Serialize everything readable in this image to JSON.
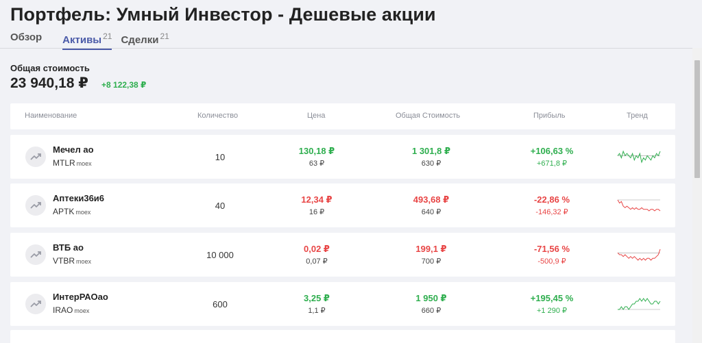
{
  "title": "Портфель: Умный Инвестор - Дешевые акции",
  "tabs": [
    {
      "label": "Обзор",
      "count": ""
    },
    {
      "label": "Активы",
      "count": "21"
    },
    {
      "label": "Сделки",
      "count": "21"
    }
  ],
  "summary": {
    "label": "Общая стоимость",
    "value": "23 940,18 ₽",
    "delta": "+8 122,38 ₽"
  },
  "columns": [
    "Наименование",
    "Количество",
    "Цена",
    "Общая Стоимость",
    "Прибыль",
    "Тренд"
  ],
  "rows": [
    {
      "name": "Мечел ао",
      "ticker": "MTLR",
      "exchange": "moex",
      "quantity": "10",
      "price": "130,18 ₽",
      "price_buy": "63 ₽",
      "cost": "1 301,8 ₽",
      "cost_buy": "630 ₽",
      "profit_pct": "+106,63 %",
      "profit_abs": "+671,8 ₽",
      "direction": "up",
      "trend": [
        5,
        6,
        4,
        7,
        5,
        6,
        5,
        4,
        6,
        3,
        5,
        4,
        6,
        2,
        4,
        3,
        5,
        4,
        3,
        5,
        4,
        6,
        5,
        7
      ]
    },
    {
      "name": "Аптеки36и6",
      "ticker": "APTK",
      "exchange": "moex",
      "quantity": "40",
      "price": "12,34 ₽",
      "price_buy": "16 ₽",
      "cost": "493,68 ₽",
      "cost_buy": "640 ₽",
      "profit_pct": "-22,86 %",
      "profit_abs": "-146,32 ₽",
      "direction": "down",
      "trend": [
        9,
        7,
        8,
        5,
        4,
        5,
        4,
        3,
        4,
        3,
        4,
        3,
        3,
        4,
        3,
        3,
        3,
        2,
        3,
        3,
        2,
        3,
        3,
        2
      ]
    },
    {
      "name": "ВТБ ао",
      "ticker": "VTBR",
      "exchange": "moex",
      "quantity": "10 000",
      "price": "0,02 ₽",
      "price_buy": "0,07 ₽",
      "cost": "199,1 ₽",
      "cost_buy": "700 ₽",
      "profit_pct": "-71,56 %",
      "profit_abs": "-500,9 ₽",
      "direction": "down",
      "trend": [
        6,
        5,
        5,
        4,
        5,
        4,
        3,
        4,
        3,
        4,
        3,
        2,
        3,
        2,
        3,
        2,
        3,
        3,
        2,
        3,
        3,
        4,
        5,
        8
      ]
    },
    {
      "name": "ИнтерРАОао",
      "ticker": "IRAO",
      "exchange": "moex",
      "quantity": "600",
      "price": "3,25 ₽",
      "price_buy": "1,1 ₽",
      "cost": "1 950 ₽",
      "cost_buy": "660 ₽",
      "profit_pct": "+195,45 %",
      "profit_abs": "+1 290 ₽",
      "direction": "up",
      "trend": [
        3,
        3,
        4,
        3,
        4,
        4,
        3,
        4,
        5,
        5,
        6,
        6,
        7,
        6,
        7,
        6,
        7,
        6,
        5,
        5,
        6,
        6,
        5,
        6
      ]
    }
  ],
  "colors": {
    "up": "#2eae4e",
    "down": "#e84545",
    "accent": "#4a5aa8"
  }
}
